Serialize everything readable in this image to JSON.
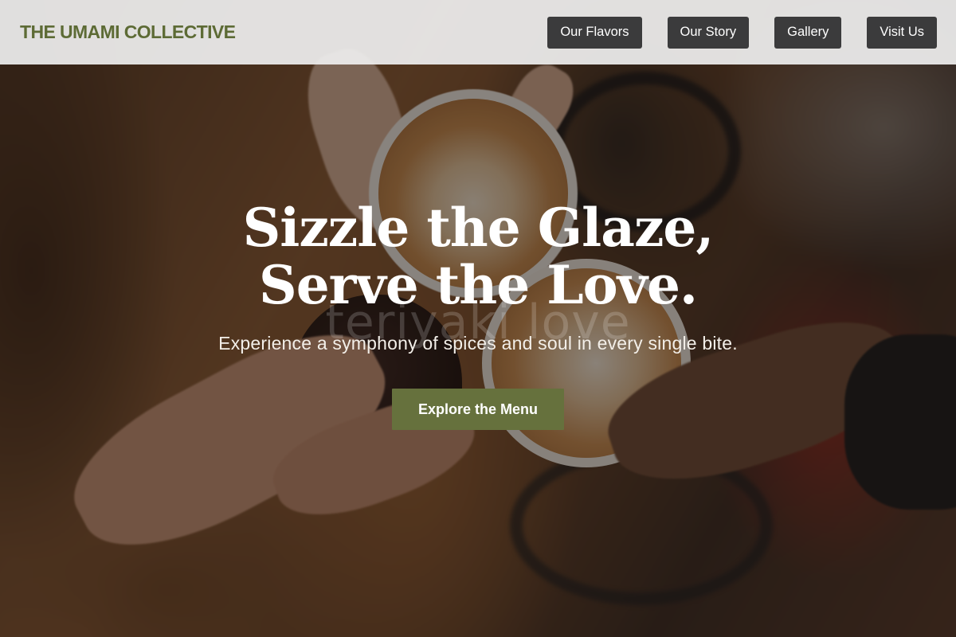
{
  "header": {
    "brand": "THE UMAMI COLLECTIVE",
    "nav": [
      {
        "label": "Our Flavors"
      },
      {
        "label": "Our Story"
      },
      {
        "label": "Gallery"
      },
      {
        "label": "Visit Us"
      }
    ]
  },
  "hero": {
    "headline": "Sizzle the Glaze, Serve the Love.",
    "watermark": "teriyaki love",
    "tagline": "Experience a symphony of spices and soul in every single bite.",
    "cta_label": "Explore the Menu"
  },
  "colors": {
    "brand": "#5d6b35",
    "nav_button_bg": "#3b3b3c",
    "cta_bg": "#66713d",
    "header_bg": "#eeeeee"
  }
}
